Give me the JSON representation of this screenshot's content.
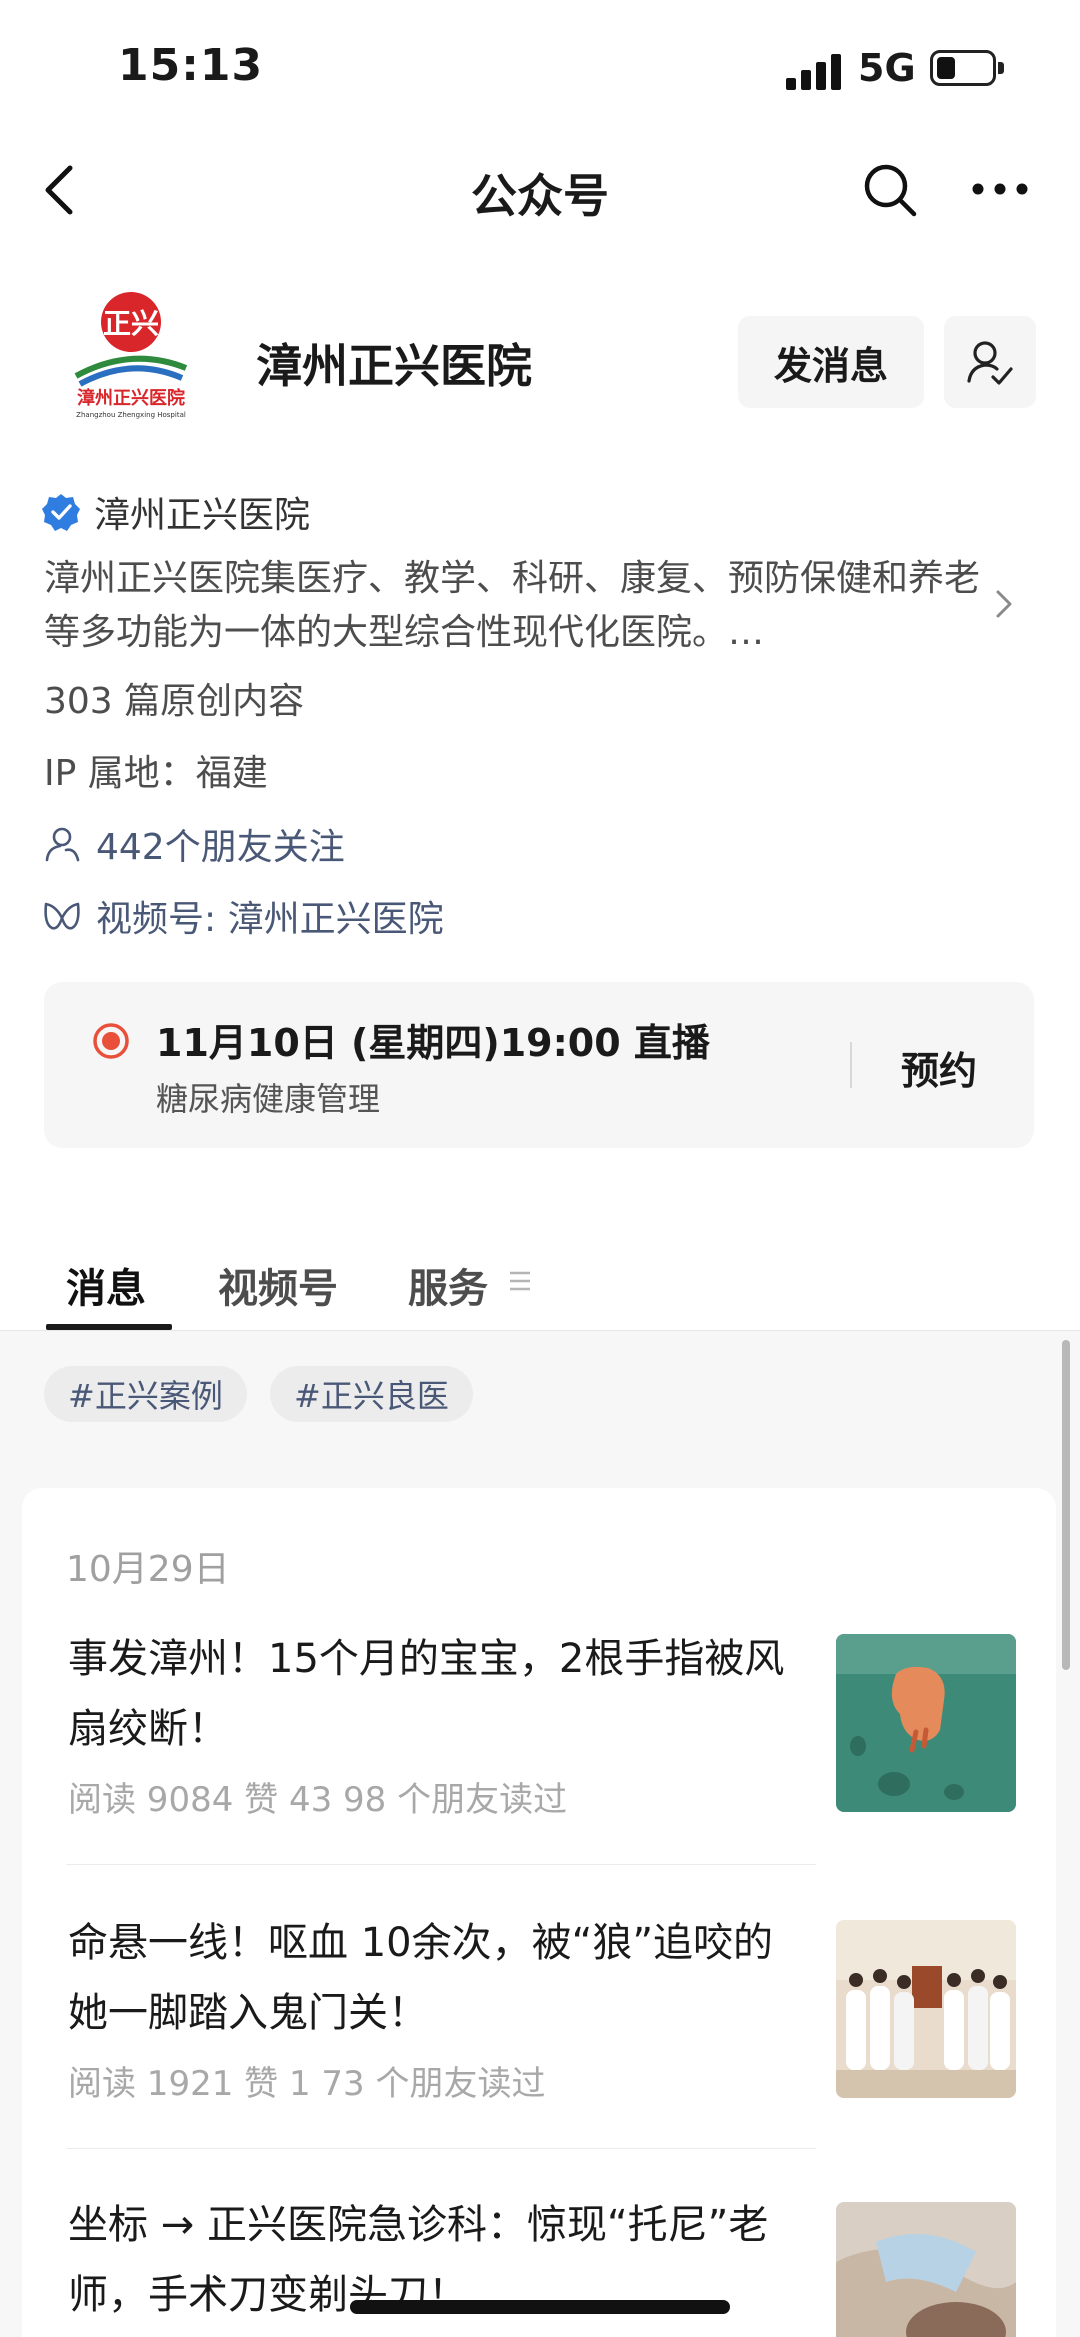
{
  "status_bar": {
    "time": "15:13",
    "network": "5G"
  },
  "nav": {
    "title": "公众号"
  },
  "profile": {
    "name": "漳州正兴医院",
    "send_message_label": "发消息",
    "logo_text": "正兴",
    "logo_caption": "漳州正兴医院",
    "logo_caption_en": "Zhangzhou Zhengxing Hospital",
    "verified_name": "漳州正兴医院",
    "description": "漳州正兴医院集医疗、教学、科研、康复、预防保健和养老等多功能为一体的大型综合性现代化医院。…",
    "original_count": "303 篇原创内容",
    "ip_location": "IP 属地：福建",
    "friends_following": "442个朋友关注",
    "video_channel": "视频号: 漳州正兴医院"
  },
  "live": {
    "title": "11月10日 (星期四)19:00 直播",
    "subtitle": "糖尿病健康管理",
    "button_label": "预约"
  },
  "tabs": [
    {
      "label": "消息",
      "active": true
    },
    {
      "label": "视频号",
      "active": false
    },
    {
      "label": "服务",
      "active": false
    }
  ],
  "tags": [
    "#正兴案例",
    "#正兴良医"
  ],
  "feed": {
    "date": "10月29日",
    "articles": [
      {
        "title": "事发漳州！15个月的宝宝，2根手指被风扇绞断！",
        "meta": "阅读 9084  赞 43  98 个朋友读过"
      },
      {
        "title": "命悬一线！呕血 10余次，被“狼”追咬的她一脚踏入鬼门关！",
        "meta": "阅读 1921  赞 1  73 个朋友读过"
      },
      {
        "title": "坐标 → 正兴医院急诊科：惊现“托尼”老师，手术刀变剃头刀！",
        "meta": ""
      }
    ]
  },
  "colors": {
    "link_blue_gray": "#4a5877",
    "verified_blue": "#2f7de1",
    "live_red": "#e8503a",
    "logo_red": "#d8262a"
  }
}
